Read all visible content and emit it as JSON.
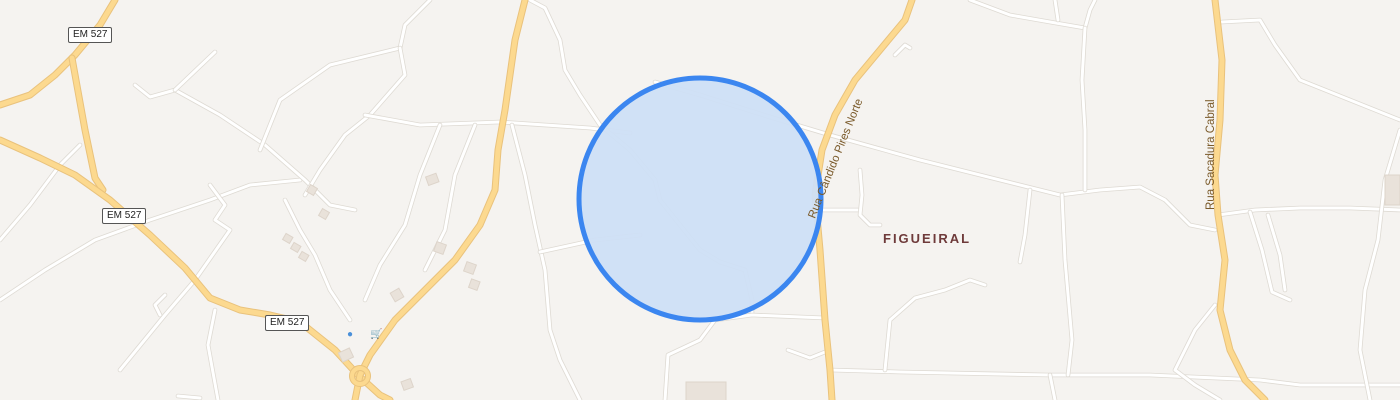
{
  "map": {
    "road_shields": [
      {
        "id": "shield-1",
        "label": "EM 527"
      },
      {
        "id": "shield-2",
        "label": "EM 527"
      },
      {
        "id": "shield-3",
        "label": "EM 527"
      }
    ],
    "place_label": "FIGUEIRAL",
    "street_labels": {
      "pires_norte": "Rua Cândido Pires Norte",
      "sacadura": "Rua Sacadura Cabral"
    },
    "location_marker": {
      "color": "#3b86f0",
      "fill": "#cddff5"
    },
    "colors": {
      "background": "#f5f3f0",
      "major_road": "#fcd98f",
      "minor_road": "#ffffff",
      "place_label": "#6e3a3a"
    },
    "icons": [
      "cart-icon",
      "water-icon"
    ]
  }
}
